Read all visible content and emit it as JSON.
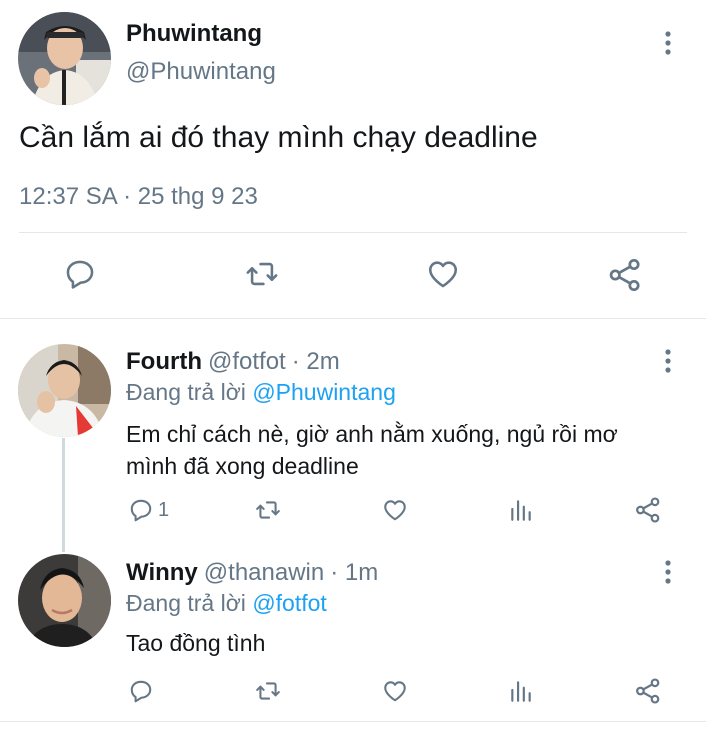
{
  "main_tweet": {
    "author_name": "Phuwintang",
    "handle": "@Phuwintang",
    "text": "Cần lắm ai đó thay mình chạy deadline",
    "timestamp": "12:37 SA · 25 thg 9 23",
    "actions": [
      "reply-icon",
      "retweet-icon",
      "like-icon",
      "share-icon"
    ]
  },
  "replies": [
    {
      "author_name": "Fourth",
      "handle": "@fotfot",
      "time": "· 2m",
      "replying_prefix": "Đang trả lời",
      "replying_to": "@Phuwintang",
      "text_line1": "Em chỉ cách nè, giờ anh nằm xuống, ngủ rồi mơ",
      "text_line2": "mình đã xong deadline",
      "reply_count": "1",
      "actions": [
        "reply-icon",
        "retweet-icon",
        "like-icon",
        "analytics-icon",
        "share-icon"
      ]
    },
    {
      "author_name": "Winny",
      "handle": "@thanawin",
      "time": "· 1m",
      "replying_prefix": "Đang trả lời",
      "replying_to": "@fotfot",
      "text": "Tao đồng tình",
      "actions": [
        "reply-icon",
        "retweet-icon",
        "like-icon",
        "analytics-icon",
        "share-icon"
      ]
    }
  ],
  "colors": {
    "text": "#14171a",
    "secondary": "#657786",
    "link": "#1da1f2",
    "divider": "#e1e8ed"
  }
}
